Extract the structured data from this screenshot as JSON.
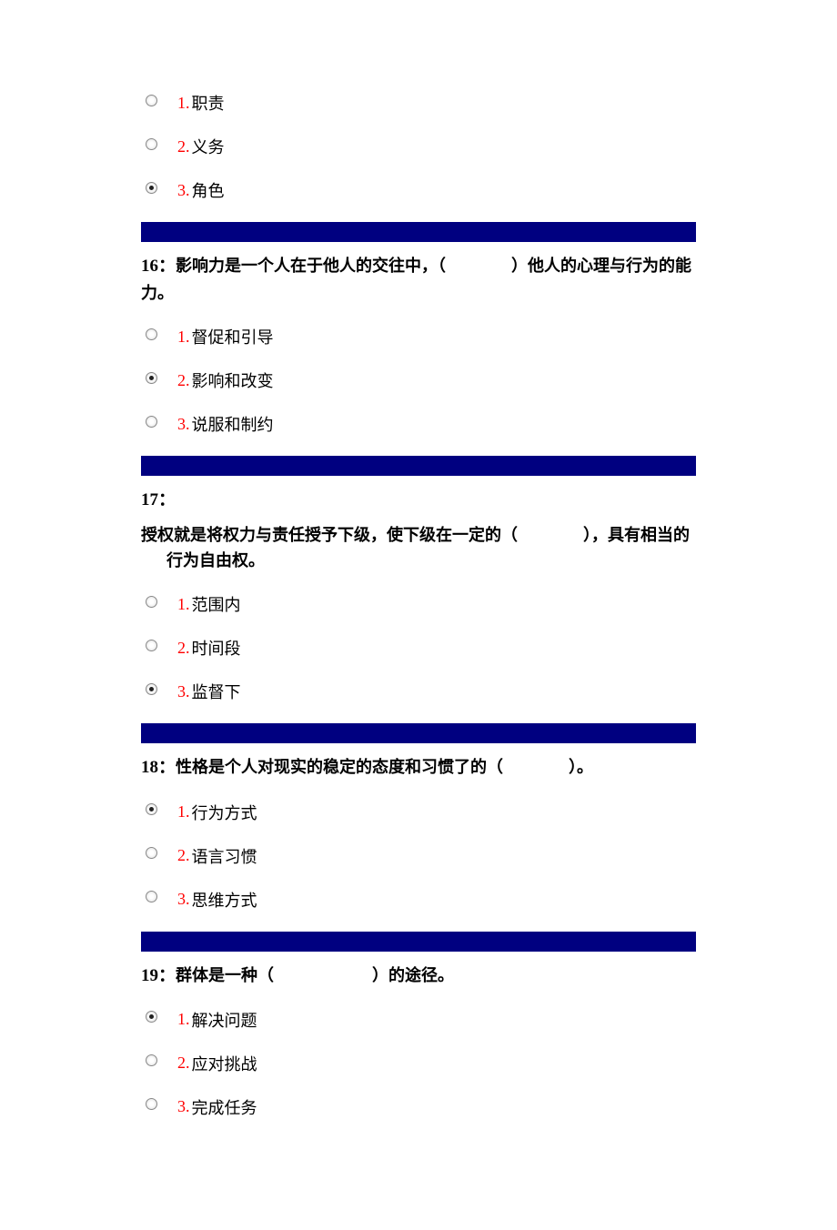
{
  "questions": [
    {
      "number": "",
      "text": "",
      "options": [
        {
          "num": "1.",
          "text": "职责",
          "checked": false
        },
        {
          "num": "2.",
          "text": "义务",
          "checked": false
        },
        {
          "num": "3.",
          "text": "角色",
          "checked": true
        }
      ]
    },
    {
      "number": "16：",
      "text": "影响力是一个人在于他人的交往中，（　　　　）他人的心理与行为的能力。",
      "options": [
        {
          "num": "1.",
          "text": "督促和引导",
          "checked": false
        },
        {
          "num": "2.",
          "text": "影响和改变",
          "checked": true
        },
        {
          "num": "3.",
          "text": "说服和制约",
          "checked": false
        }
      ]
    },
    {
      "number": "17：",
      "text": "",
      "sub_text": "授权就是将权力与责任授予下级，使下级在一定的（　　　　），具有相当的行为自由权。",
      "options": [
        {
          "num": "1.",
          "text": "范围内",
          "checked": false
        },
        {
          "num": "2.",
          "text": "时间段",
          "checked": false
        },
        {
          "num": "3.",
          "text": "监督下",
          "checked": true
        }
      ]
    },
    {
      "number": "18：",
      "text": "性格是个人对现实的稳定的态度和习惯了的（　　　　）。",
      "options": [
        {
          "num": "1.",
          "text": "行为方式",
          "checked": true
        },
        {
          "num": "2.",
          "text": "语言习惯",
          "checked": false
        },
        {
          "num": "3.",
          "text": "思维方式",
          "checked": false
        }
      ]
    },
    {
      "number": "19：",
      "text": "群体是一种（　　　　　　）的途径。",
      "options": [
        {
          "num": "1.",
          "text": "解决问题",
          "checked": true
        },
        {
          "num": "2.",
          "text": "应对挑战",
          "checked": false
        },
        {
          "num": "3.",
          "text": "完成任务",
          "checked": false
        }
      ]
    }
  ]
}
